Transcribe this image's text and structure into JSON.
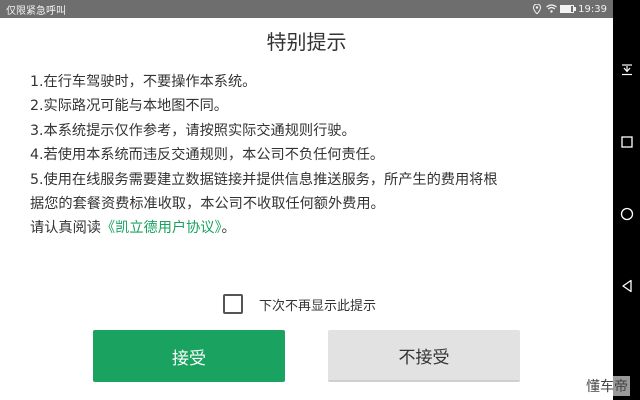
{
  "status_bar": {
    "left_text": "仅限紧急呼叫",
    "time": "19:39",
    "icons": [
      "location-icon",
      "wifi-icon",
      "battery-icon"
    ],
    "background": "#6e6e6e"
  },
  "dialog": {
    "title": "特别提示",
    "lines": [
      "1.在行车驾驶时，不要操作本系统。",
      "2.实际路况可能与本地图不同。",
      "3.本系统提示仅作参考，请按照实际交通规则行驶。",
      "4.若使用本系统而违反交通规则，本公司不负任何责任。",
      "5.使用在线服务需要建立数据链接并提供信息推送服务，所产生的费用将根",
      "据您的套餐资费标准收取，本公司不收取任何额外费用。"
    ],
    "read_prefix": "请认真阅读",
    "agreement_link": "《凯立德用户协议》",
    "read_suffix": "。",
    "checkbox_label": "下次不再显示此提示",
    "checkbox_checked": false,
    "accept_label": "接受",
    "decline_label": "不接受",
    "accent_color": "#1aa260"
  },
  "navbar": {
    "items": [
      "collapse-icon",
      "recent-apps-icon",
      "home-icon",
      "back-icon"
    ]
  },
  "watermark": "懂车帝"
}
